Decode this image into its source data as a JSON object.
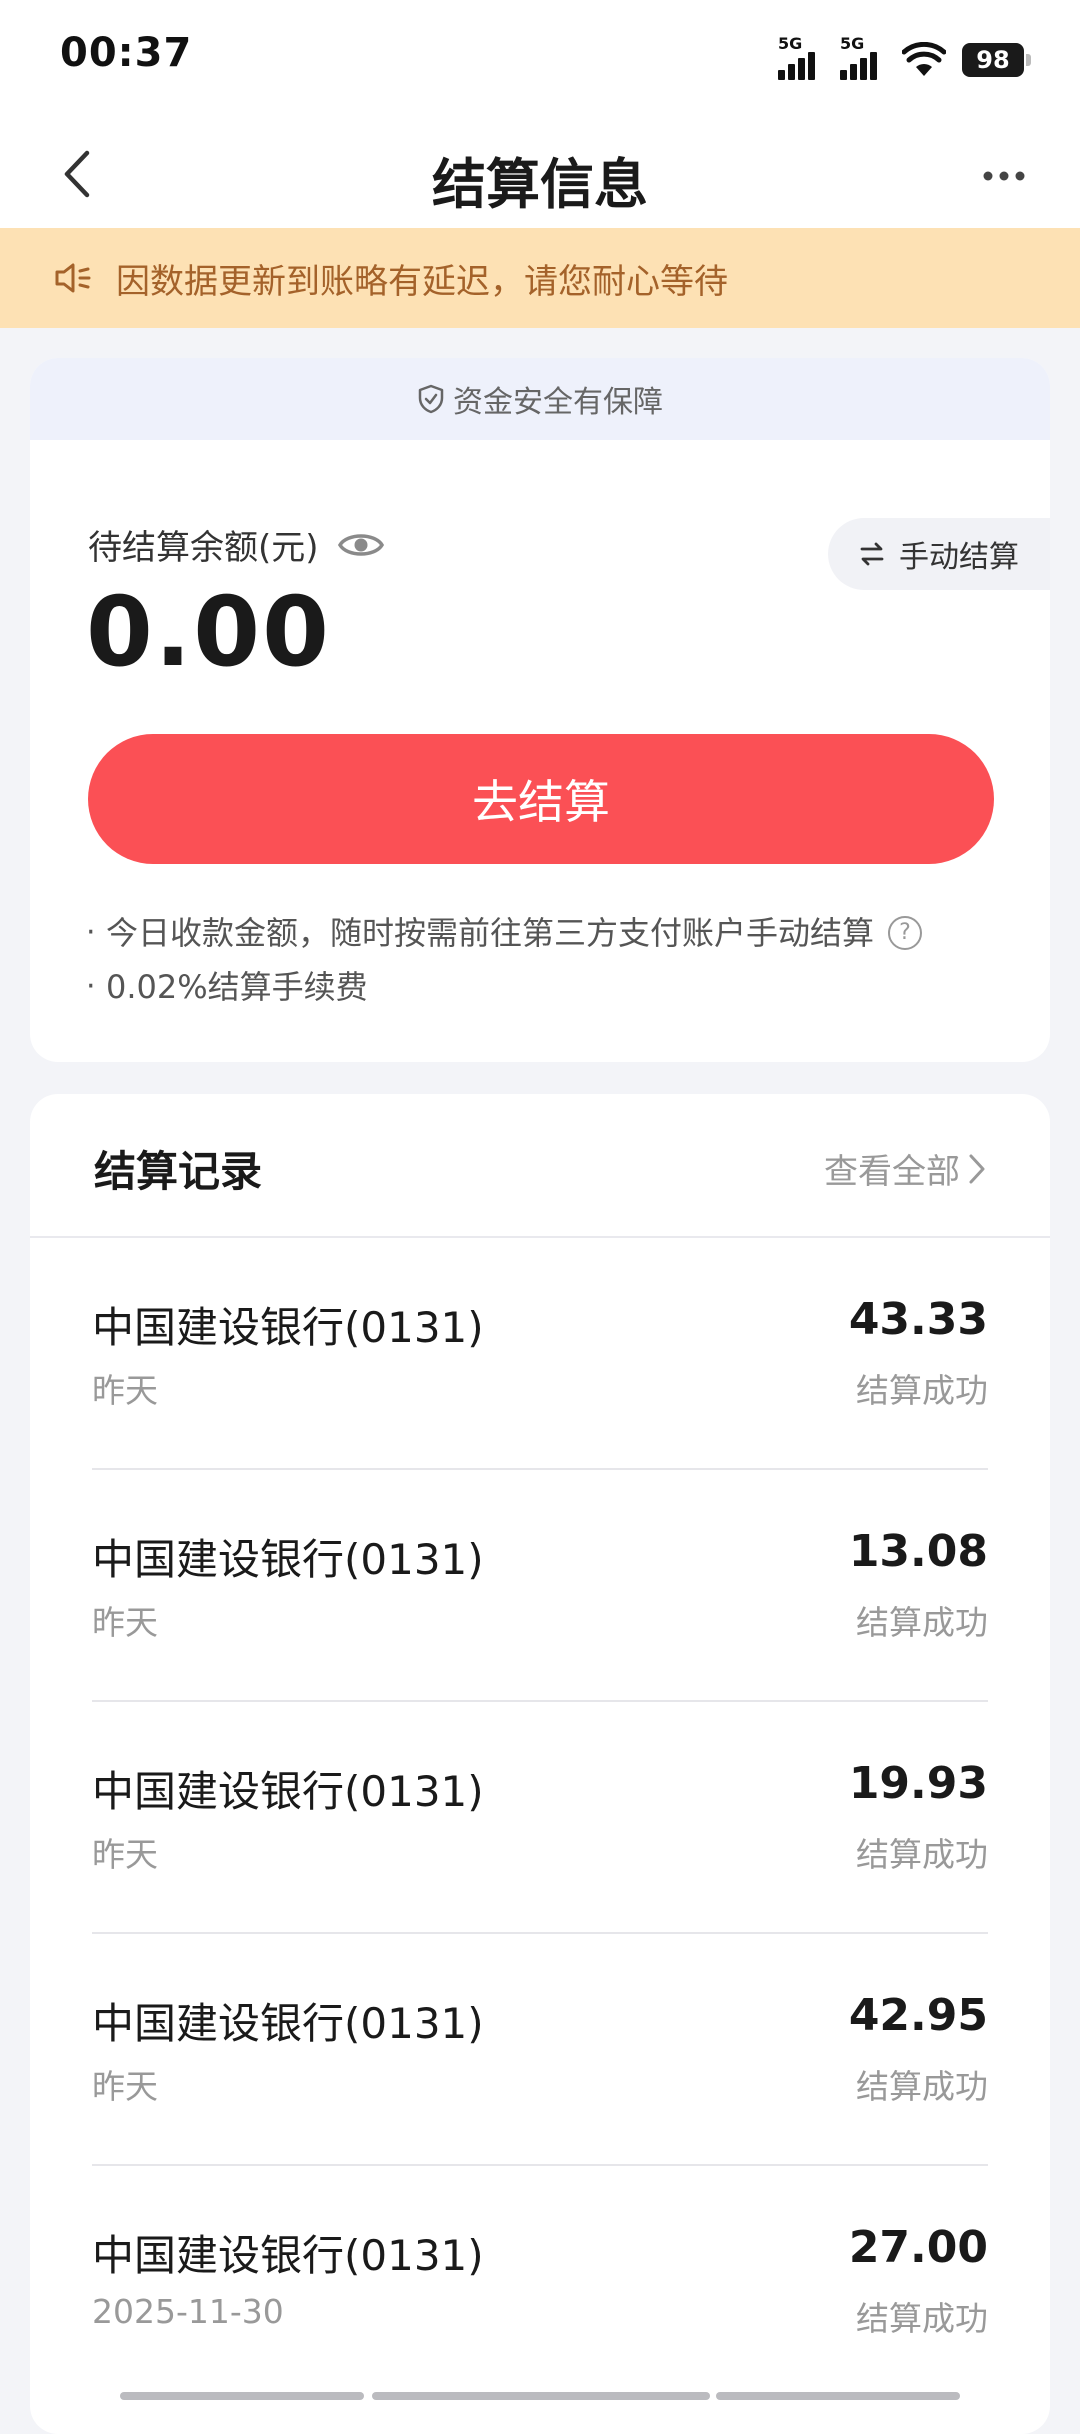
{
  "status_bar": {
    "time": "00:37",
    "sim1_label": "5G",
    "sim2_label": "5G",
    "battery": "98"
  },
  "nav": {
    "title": "结算信息",
    "back_icon": "chevron-left-icon",
    "more_icon": "more-dots-icon"
  },
  "notice": {
    "icon": "speaker-icon",
    "text": "因数据更新到账略有延迟，请您耐心等待"
  },
  "balance_card": {
    "security_text": "资金安全有保障",
    "label": "待结算余额(元)",
    "value": "0.00",
    "manual_button": "手动结算",
    "settle_button": "去结算",
    "tips": [
      "今日收款金额，随时按需前往第三方支付账户手动结算",
      "0.02%结算手续费"
    ]
  },
  "records": {
    "title": "结算记录",
    "view_all": "查看全部",
    "items": [
      {
        "bank": "中国建设银行(0131)",
        "date": "昨天",
        "amount": "43.33",
        "status": "结算成功"
      },
      {
        "bank": "中国建设银行(0131)",
        "date": "昨天",
        "amount": "13.08",
        "status": "结算成功"
      },
      {
        "bank": "中国建设银行(0131)",
        "date": "昨天",
        "amount": "19.93",
        "status": "结算成功"
      },
      {
        "bank": "中国建设银行(0131)",
        "date": "昨天",
        "amount": "42.95",
        "status": "结算成功"
      },
      {
        "bank": "中国建设银行(0131)",
        "date": "2025-11-30",
        "amount": "27.00",
        "status": "结算成功"
      }
    ]
  },
  "colors": {
    "accent_red": "#fb5055",
    "notice_bg": "#fde1b4",
    "notice_text": "#a4622a"
  }
}
